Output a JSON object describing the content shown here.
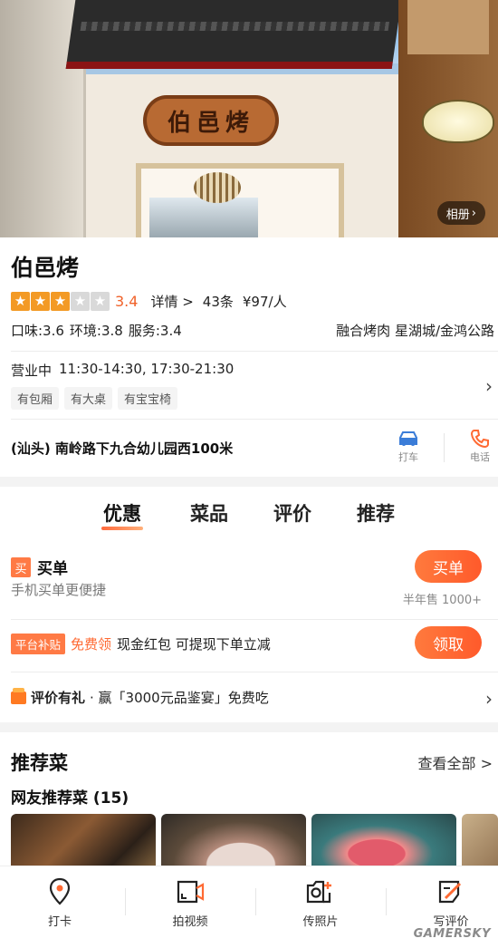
{
  "hero": {
    "album_label": "相册",
    "sign_text": "伯邑烤"
  },
  "shop": {
    "name": "伯邑烤",
    "rating": 3.4,
    "rating_text": "3.4",
    "detail_label": "详情 >",
    "review_count": "43条",
    "price": "¥97/人",
    "taste": "口味:3.6",
    "env": "环境:3.8",
    "service": "服务:3.4",
    "category_area": "融合烤肉  星湖城/金鸿公路",
    "status": "营业中",
    "hours": "11:30-14:30, 17:30-21:30",
    "tags": [
      "有包厢",
      "有大桌",
      "有宝宝椅"
    ],
    "address": "(汕头) 南岭路下九合幼儿园西100米",
    "actions": [
      {
        "label": "打车",
        "icon": "car-icon",
        "color": "#3b7dd8"
      },
      {
        "label": "电话",
        "icon": "phone-icon",
        "color": "#ff6a33"
      }
    ]
  },
  "tabs": [
    "优惠",
    "菜品",
    "评价",
    "推荐"
  ],
  "deals": {
    "maidan_badge": "买",
    "maidan_title": "买单",
    "maidan_sub": "手机买单更便捷",
    "maidan_button": "买单",
    "sold_text": "半年售 1000+",
    "subsidy_badge": "平台补贴",
    "subsidy_free": "免费领",
    "subsidy_text": "现金红包 可提现下单立减",
    "subsidy_button": "领取",
    "review_title": "评价有礼",
    "review_text": "· 赢「3000元品鉴宴」免费吃"
  },
  "recommend": {
    "title": "推荐菜",
    "view_all": "查看全部 >",
    "subtitle": "网友推荐菜 (15)"
  },
  "bottom_bar": [
    {
      "label": "打卡",
      "icon": "location-pin-icon"
    },
    {
      "label": "拍视频",
      "icon": "video-camera-icon"
    },
    {
      "label": "传照片",
      "icon": "add-photo-icon"
    },
    {
      "label": "写评价",
      "icon": "write-review-icon"
    }
  ],
  "watermark": "GAMERSKY",
  "colors": {
    "accent": "#ff6a33",
    "star_on": "#f39a25",
    "star_off": "#d9d9d9",
    "link_blue": "#3b7dd8"
  }
}
